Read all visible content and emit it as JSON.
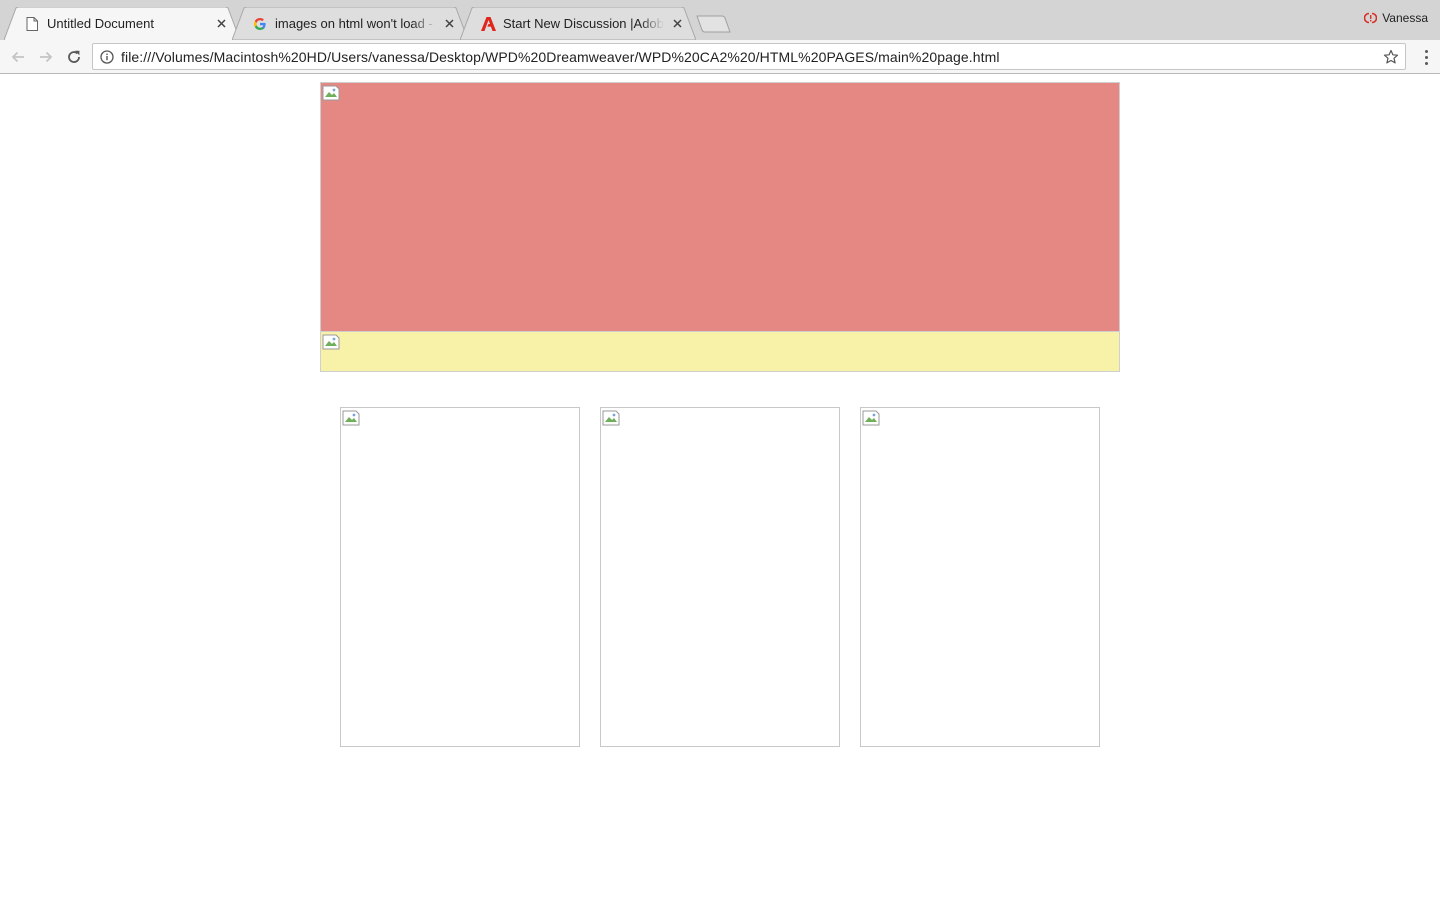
{
  "browser": {
    "tabs": [
      {
        "title": "Untitled Document",
        "favicon": "page-icon",
        "active": true
      },
      {
        "title": "images on html won't load - Google Search",
        "favicon": "google-icon",
        "active": false
      },
      {
        "title": "Start New Discussion |Adobe Community",
        "favicon": "adobe-icon",
        "active": false
      }
    ],
    "profile_name": "Vanessa",
    "url": "file:///Volumes/Macintosh%20HD/Users/vanessa/Desktop/WPD%20Dreamweaver/WPD%20CA2%20/HTML%20PAGES/main%20page.html"
  },
  "page": {
    "banner_color": "#e58884",
    "navbar_color": "#f8f2a8",
    "thumbnails": [
      "broken-image",
      "broken-image",
      "broken-image"
    ]
  }
}
